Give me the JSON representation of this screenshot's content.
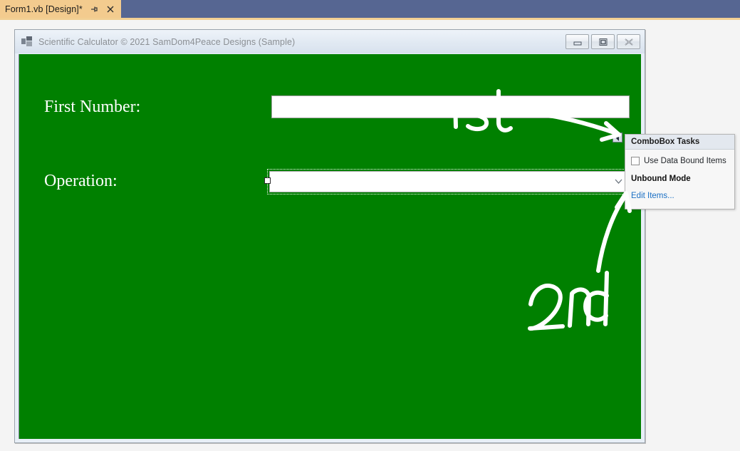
{
  "ide": {
    "tab": {
      "label": "Form1.vb [Design]*",
      "pin_icon": "pin-icon",
      "close_icon": "close-icon"
    }
  },
  "form": {
    "title": "Scientific Calculator © 2021 SamDom4Peace Designs (Sample)",
    "app_icon": "form-app-icon",
    "window_buttons": {
      "minimize": "minimize-icon",
      "maximize": "maximize-icon",
      "close": "close-icon"
    },
    "controls": {
      "first_number_label": "First Number:",
      "first_number_value": "",
      "first_number_placeholder": "",
      "operation_label": "Operation:",
      "operation_value": "",
      "operation_placeholder": "",
      "combobox_chevron_icon": "chevron-down-icon"
    },
    "background_color": "#008000",
    "label_color": "#ffffff"
  },
  "smart_tag": {
    "glyph_icon": "smart-tag-triangle-icon"
  },
  "tasks_panel": {
    "header": "ComboBox Tasks",
    "use_data_bound_items_label": "Use Data Bound Items",
    "use_data_bound_items_checked": false,
    "mode_label": "Unbound Mode",
    "edit_items_link": "Edit Items...",
    "link_color": "#1a6fc4"
  },
  "annotations": [
    {
      "text": "1st",
      "note": "handwritten marker pointing to smart tag button"
    },
    {
      "text": "2nd",
      "note": "handwritten marker pointing to Edit Items link"
    }
  ],
  "annotation_color": "#ffffff"
}
